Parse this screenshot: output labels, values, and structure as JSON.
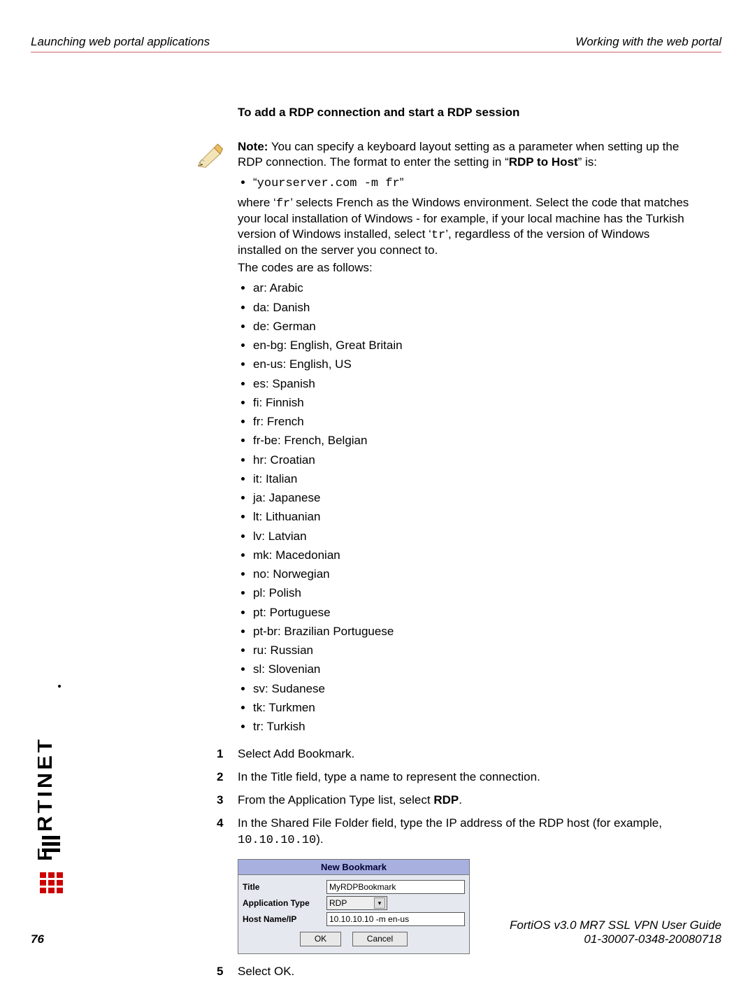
{
  "header": {
    "left": "Launching web portal applications",
    "right": "Working with the web portal"
  },
  "section_title": "To add a RDP connection and start a RDP session",
  "note": {
    "lead_strong": "Note:",
    "lead_rest": " You can specify a keyboard layout setting as a parameter when setting up the RDP connection. The format to enter the setting in “",
    "lead_bold2": "RDP to Host",
    "lead_rest2": "” is:",
    "example_quote_open": "“",
    "example_code": "yourserver.com -m fr",
    "example_quote_close": "”",
    "where_1": "where ‘",
    "where_code1": "fr",
    "where_2": "’ selects French as the Windows environment. Select the code that matches your local installation of Windows - for example, if your local machine has the Turkish version of Windows installed, select ‘",
    "where_code2": "tr",
    "where_3": "’, regardless of the version of Windows installed on the server you connect to.",
    "codes_intro": "The codes are as follows:",
    "codes": [
      "ar: Arabic",
      "da: Danish",
      "de: German",
      "en-bg: English, Great Britain",
      "en-us: English, US",
      "es: Spanish",
      "fi: Finnish",
      "fr: French",
      "fr-be: French, Belgian",
      "hr: Croatian",
      "it: Italian",
      "ja: Japanese",
      "lt: Lithuanian",
      "lv: Latvian",
      "mk: Macedonian",
      "no: Norwegian",
      "pl: Polish",
      "pt: Portuguese",
      "pt-br: Brazilian Portuguese",
      "ru: Russian",
      "sl: Slovenian",
      "sv: Sudanese",
      "tk: Turkmen",
      "tr: Turkish"
    ]
  },
  "steps": [
    {
      "n": "1",
      "pre": "Select Add Bookmark."
    },
    {
      "n": "2",
      "pre": "In the Title field, type a name to represent the connection."
    },
    {
      "n": "3",
      "pre": "From the Application Type list, select ",
      "bold": "RDP",
      "post": "."
    },
    {
      "n": "4",
      "pre": "In the Shared File Folder field, type the IP address of the RDP host (for example, ",
      "code": "10.10.10.10",
      "post": ")."
    },
    {
      "n": "5",
      "pre": "Select OK."
    }
  ],
  "bookmark": {
    "header": "New Bookmark",
    "rows": {
      "title_label": "Title",
      "title_value": "MyRDPBookmark",
      "apptype_label": "Application Type",
      "apptype_value": "RDP",
      "host_label": "Host Name/IP",
      "host_value": "10.10.10.10 -m en-us"
    },
    "ok": "OK",
    "cancel": "Cancel"
  },
  "logo_text": "F≡RTINET",
  "footer": {
    "page": "76",
    "guide": "FortiOS v3.0 MR7 SSL VPN User Guide",
    "docnum": "01-30007-0348-20080718"
  }
}
